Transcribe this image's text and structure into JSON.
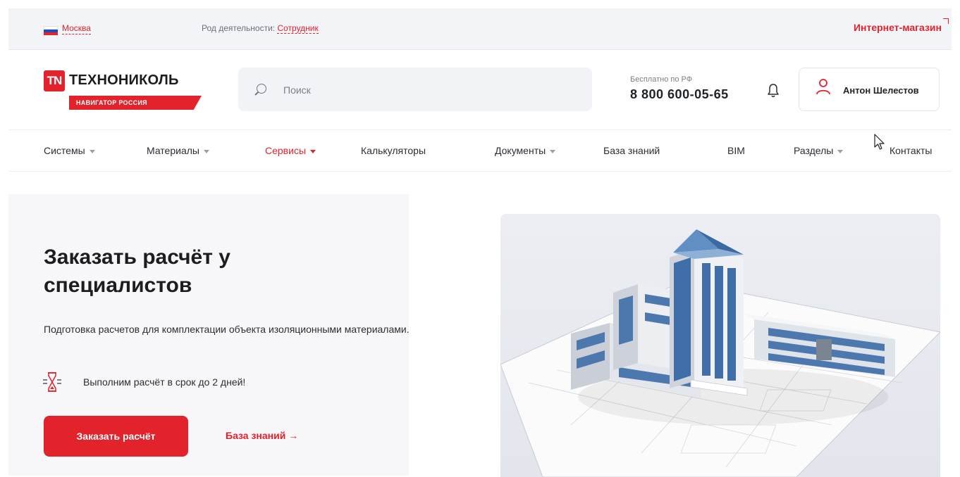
{
  "topbar": {
    "city": "Москва",
    "activity_label": "Род деятельности:",
    "activity_value": "Сотрудник",
    "shop_link": "Интернет-магазин"
  },
  "header": {
    "logo_mark": "TN",
    "logo_text": "ТЕХНОНИКОЛЬ",
    "logo_badge": "НАВИГАТОР РОССИЯ",
    "search_placeholder": "Поиск",
    "phone_caption": "Бесплатно по РФ",
    "phone": "8 800 600-05-65",
    "user_name": "Антон Шелестов"
  },
  "nav": {
    "items": [
      {
        "label": "Системы",
        "dropdown": true
      },
      {
        "label": "Материалы",
        "dropdown": true
      },
      {
        "label": "Сервисы",
        "dropdown": true,
        "active": true
      },
      {
        "label": "Калькуляторы",
        "dropdown": false
      },
      {
        "label": "Документы",
        "dropdown": true
      },
      {
        "label": "База знаний",
        "dropdown": false
      },
      {
        "label": "BIM",
        "dropdown": false
      },
      {
        "label": "Разделы",
        "dropdown": true
      },
      {
        "label": "Контакты",
        "dropdown": false
      }
    ]
  },
  "hero": {
    "title": "Заказать расчёт у специалистов",
    "description": "Подготовка расчетов для комплектации объекта изоляционными материалами.",
    "feature": "Выполним расчёт в срок до 2 дней!",
    "order_button": "Заказать расчёт",
    "kb_link": "База знаний →"
  },
  "colors": {
    "accent": "#e3232c",
    "text": "#1f2228",
    "topbar_bg": "#f3f4f8"
  },
  "icons": [
    "flag-russia-icon",
    "external-arrow-icon",
    "search-icon",
    "bell-icon",
    "user-icon",
    "chevron-down-icon",
    "hourglass-icon",
    "cursor-pointer-icon"
  ]
}
